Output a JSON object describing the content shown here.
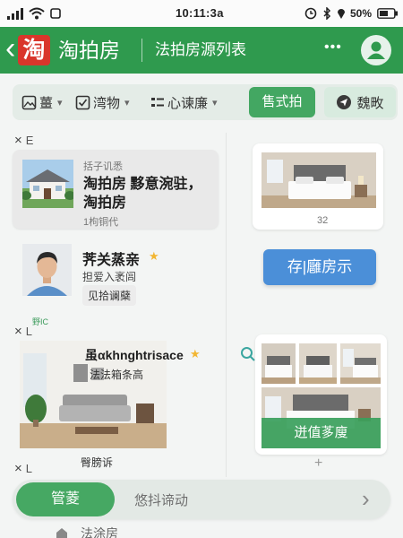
{
  "status_bar": {
    "time": "10:11:3a",
    "battery": "50%"
  },
  "header": {
    "back": "‹",
    "logo": "淘",
    "app_name": "淘拍房",
    "page_title": "法拍房源列表",
    "more": "•••"
  },
  "filters": [
    {
      "icon": "image-icon",
      "label": "薑",
      "caret": "▾"
    },
    {
      "icon": "checkbox-icon",
      "label": "湾物",
      "caret": "▾"
    },
    {
      "icon": "list-icon",
      "label": "心谏廉",
      "caret": "▾"
    }
  ],
  "actions": {
    "primary": "售式拍",
    "secondary": "魏畋",
    "secondary_icon": "send-icon"
  },
  "sections": [
    {
      "close": "×",
      "label": "E"
    },
    {
      "tag": "野IC",
      "close": "×",
      "label": "L"
    },
    {
      "close": "×",
      "label": "L"
    }
  ],
  "listings": {
    "house": {
      "meta": "括子讥悉",
      "title_line1": "淘拍房 黟意涴驻，",
      "title_line2": "淘拍房",
      "footer": "1枸铜代"
    },
    "bedroom": {
      "caption": "32"
    },
    "agent": {
      "name": "荠关蒸亲",
      "star": "★",
      "subtitle": "担爱入袤闾",
      "tag": "见拾谰蘖"
    },
    "cta": {
      "label": "存|廱房示"
    },
    "living_room": {
      "title": "虽αkhnghtrisace",
      "star": "★",
      "subtitle": "法法箱条高",
      "caption": "臀膀诉"
    },
    "gallery": {
      "search_icon": "search-icon",
      "banner": "迸值茤廋",
      "add": "+"
    }
  },
  "bottom_bar": {
    "button": "管菱",
    "text": "悠抖谛动",
    "chevron": "›"
  },
  "peek": {
    "text": "法涂房"
  },
  "colors": {
    "header_green": "#2f9a4e",
    "button_green": "#43a762",
    "logo_red": "#d9362b",
    "cta_blue": "#4b8fd8",
    "star": "#f2b632"
  }
}
